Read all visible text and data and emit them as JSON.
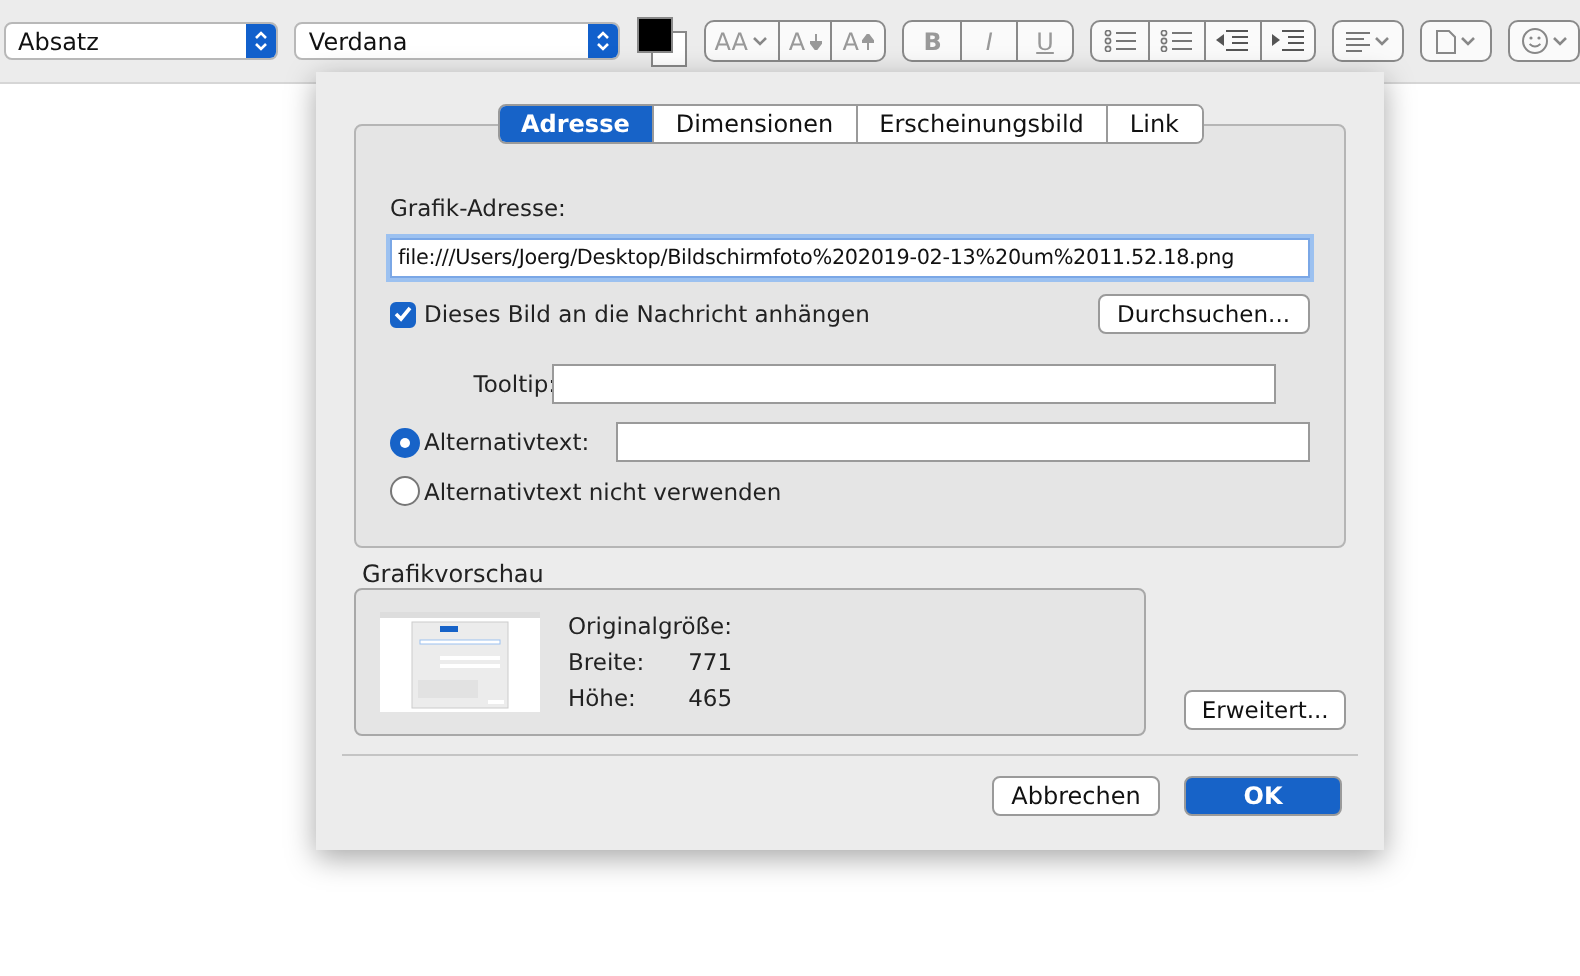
{
  "toolbar": {
    "paragraph_select": "Absatz",
    "font_select": "Verdana",
    "font_size_buttons": [
      "AA",
      "A",
      "A"
    ],
    "style_buttons": [
      "B",
      "I",
      "U"
    ]
  },
  "dialog": {
    "tabs": [
      {
        "label": "Adresse",
        "selected": true
      },
      {
        "label": "Dimensionen",
        "selected": false
      },
      {
        "label": "Erscheinungsbild",
        "selected": false
      },
      {
        "label": "Link",
        "selected": false
      }
    ],
    "address_label": "Grafik-Adresse:",
    "address_value": "file:///Users/Joerg/Desktop/Bildschirmfoto%202019-02-13%20um%2011.52.18.png",
    "attach": {
      "label": "Dieses Bild an die Nachricht anhängen",
      "checked": true
    },
    "browse_button": "Durchsuchen...",
    "tooltip_label": "Tooltip:",
    "alt_options": [
      {
        "label": "Alternativtext:",
        "selected": true,
        "kind": "field"
      },
      {
        "label": "Alternativtext nicht verwenden",
        "selected": false,
        "kind": "plain"
      }
    ],
    "preview": {
      "title": "Grafikvorschau",
      "size_label": "Originalgröße:",
      "rows": [
        {
          "label": "Breite:",
          "value": "771"
        },
        {
          "label": "Höhe:",
          "value": "465"
        }
      ]
    },
    "advanced_button": "Erweitert...",
    "cancel_button": "Abbrechen",
    "ok_button": "OK"
  }
}
